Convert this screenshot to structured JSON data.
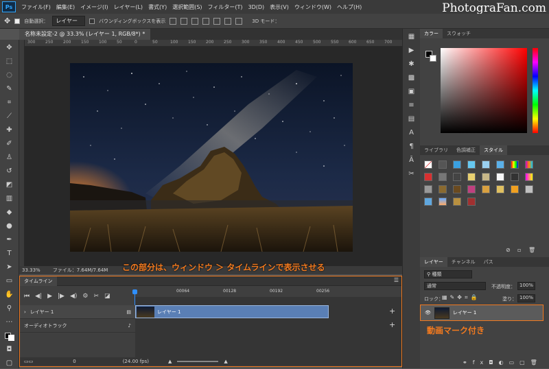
{
  "menubar": {
    "app_logo": "Ps",
    "items": [
      "ファイル(F)",
      "編集(E)",
      "イメージ(I)",
      "レイヤー(L)",
      "書式(Y)",
      "選択範囲(S)",
      "フィルター(T)",
      "3D(D)",
      "表示(V)",
      "ウィンドウ(W)",
      "ヘルプ(H)"
    ],
    "watermark": "PhotograFan.com"
  },
  "options": {
    "auto_select_label": "自動選択：",
    "auto_select_value": "レイヤー",
    "bounding_box_label": "バウンディングボックスを表示",
    "mode_3d_label": "3D モード："
  },
  "document": {
    "tab_title": "名称未設定-2 @ 33.3% (レイヤー 1, RGB/8*) *",
    "ruler_ticks": [
      "300",
      "250",
      "200",
      "150",
      "100",
      "50",
      "0",
      "50",
      "100",
      "150",
      "200",
      "250",
      "300",
      "350",
      "400",
      "450",
      "500",
      "550",
      "600",
      "650",
      "700"
    ]
  },
  "status": {
    "zoom": "33.33%",
    "file_info": "ファイル：7.64M/7.64M"
  },
  "annotations": {
    "timeline_note": "この部分は、ウィンドウ ＞ タイムラインで表示させる",
    "layer_note": "動画マーク付き"
  },
  "timeline": {
    "tab_label": "タイムライン",
    "ruler_labels": [
      "00064",
      "00128",
      "00192",
      "00256"
    ],
    "layer_track_label": "レイヤー 1",
    "audio_track_label": "オーディオトラック",
    "clip_label": "レイヤー 1",
    "frame": "0",
    "fps": "(24.00 fps)"
  },
  "color_panel": {
    "tabs": [
      "カラー",
      "スウォッチ"
    ]
  },
  "styles_panel": {
    "tabs": [
      "ライブラリ",
      "色調補正",
      "スタイル"
    ]
  },
  "layers_panel": {
    "tabs": [
      "レイヤー",
      "チャンネル",
      "パス"
    ],
    "kind_label": "種類",
    "blend_mode": "通常",
    "opacity_label": "不透明度：",
    "opacity_value": "100%",
    "lock_label": "ロック：",
    "fill_label": "塗り：",
    "fill_value": "100%",
    "layer_name": "レイヤー 1"
  },
  "colors": {
    "accent_orange": "#f27a1f",
    "playhead_blue": "#2f8fff",
    "clip_blue": "#5a7fb5"
  }
}
